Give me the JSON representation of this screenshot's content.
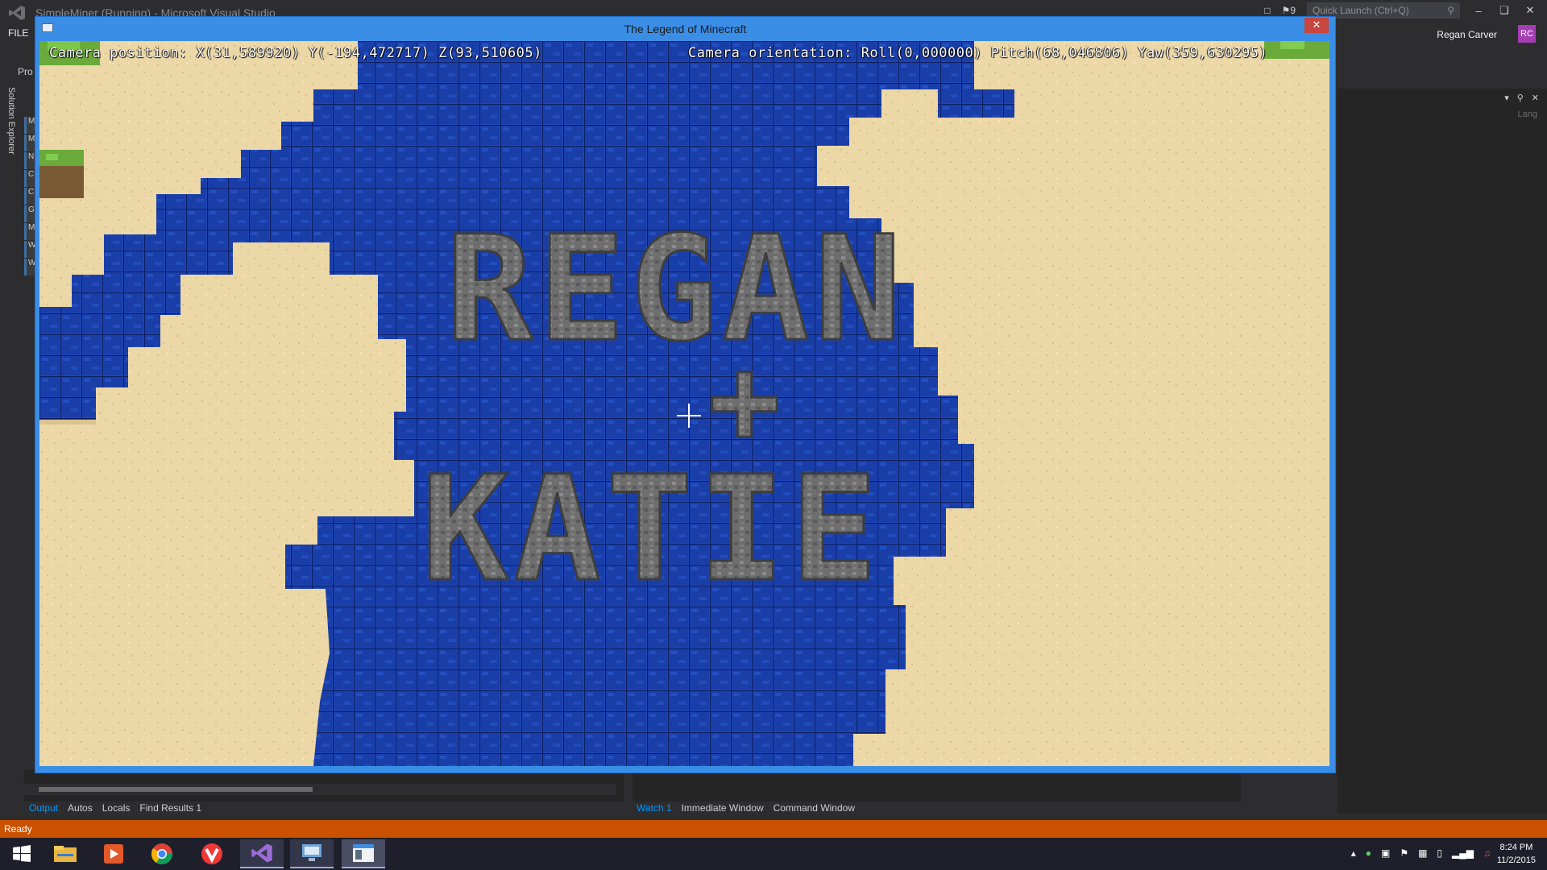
{
  "vs": {
    "title": "SimpleMiner (Running) - Microsoft Visual Studio",
    "notification_count": "9",
    "quick_launch_placeholder": "Quick Launch (Ctrl+Q)",
    "menu_file": "FILE",
    "user_name": "Regan Carver",
    "user_initials": "RC",
    "pro_label": "Pro",
    "solution_explorer_label": "Solution Explorer",
    "right_panel_lang": "Lang",
    "status": "Ready"
  },
  "bottom_left_tabs": [
    "Output",
    "Autos",
    "Locals",
    "Find Results 1"
  ],
  "bottom_right_tabs": [
    "Watch 1",
    "Immediate Window",
    "Command Window"
  ],
  "game": {
    "window_title": "The Legend of Minecraft",
    "camera_position": "Camera position: X(31,589920) Y(-194,472717) Z(93,510605)",
    "camera_orientation": "Camera orientation: Roll(0,000000) Pitch(68,046806) Yaw(359,630295)",
    "block_text_line1": "REGAN",
    "block_text_line2": "+",
    "block_text_line3": "KATIE"
  },
  "taskbar": {
    "apps": [
      "start-button",
      "file-explorer-icon",
      "media-player-icon",
      "chrome-icon",
      "vivaldi-icon",
      "visual-studio-icon",
      "remote-desktop-icon",
      "game-window-icon"
    ],
    "time": "8:24 PM",
    "date": "11/2/2015"
  },
  "colors": {
    "vs_accent": "#ca5100",
    "water": "#1a3ea8",
    "sand": "#ecd7a6",
    "stone": "#727272",
    "grass": "#6aaa3a"
  }
}
